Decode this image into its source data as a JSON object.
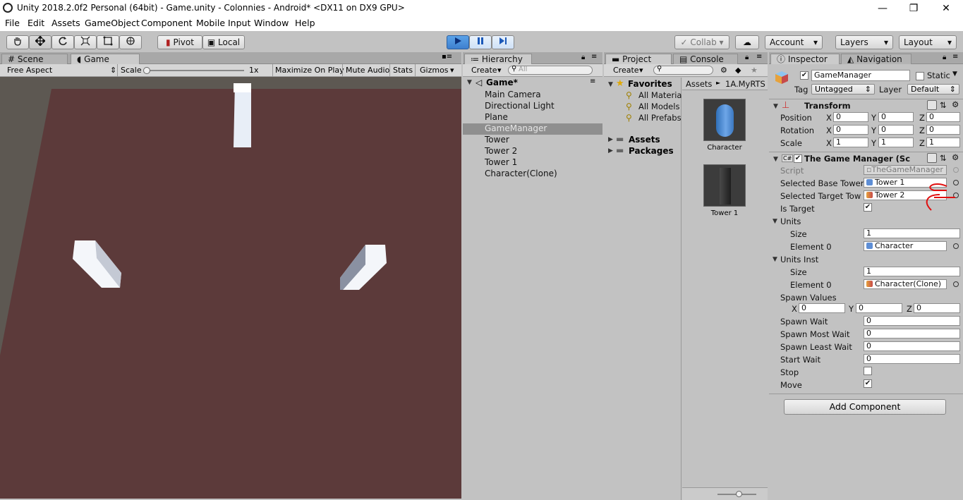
{
  "window": {
    "title": "Unity 2018.2.0f2 Personal (64bit) - Game.unity - Colonnies - Android* <DX11 on DX9 GPU>",
    "minimize": "—",
    "maximize": "❐",
    "close": "✕"
  },
  "menu": [
    "File",
    "Edit",
    "Assets",
    "GameObject",
    "Component",
    "Mobile Input",
    "Window",
    "Help"
  ],
  "toolbar": {
    "pivot": "Pivot",
    "local": "Local",
    "collab": "Collab",
    "account": "Account",
    "layers": "Layers",
    "layout": "Layout"
  },
  "tabs": {
    "scene": "Scene",
    "game": "Game",
    "hierarchy": "Hierarchy",
    "project": "Project",
    "console": "Console",
    "inspector": "Inspector",
    "navigation": "Navigation"
  },
  "game_bar": {
    "aspect": "Free Aspect",
    "scale_label": "Scale",
    "scale_value": "1x",
    "maximize": "Maximize On Play",
    "mute": "Mute Audio",
    "stats": "Stats",
    "gizmos": "Gizmos"
  },
  "hierarchy": {
    "create": "Create",
    "search_placeholder": "All",
    "scene": "Game*",
    "items": [
      "Main Camera",
      "Directional Light",
      "Plane",
      "GameManager",
      "Tower",
      "Tower 2",
      "Tower 1",
      "Character(Clone)"
    ],
    "selected_index": 3
  },
  "project": {
    "create": "Create",
    "favorites": "Favorites",
    "fav_items": [
      "All Materia",
      "All Models",
      "All Prefabs"
    ],
    "assets": "Assets",
    "packages": "Packages",
    "breadcrumb_root": "Assets",
    "breadcrumb_sep": "►",
    "breadcrumb_folder": "1A.MyRTS",
    "assets_list": [
      "Character",
      "Tower 1"
    ]
  },
  "inspector": {
    "object_name": "GameManager",
    "static_label": "Static",
    "tag_label": "Tag",
    "tag_value": "Untagged",
    "layer_label": "Layer",
    "layer_value": "Default",
    "transform": {
      "title": "Transform",
      "position_label": "Position",
      "rotation_label": "Rotation",
      "scale_label": "Scale",
      "position": [
        "0",
        "0",
        "0"
      ],
      "rotation": [
        "0",
        "0",
        "0"
      ],
      "scale": [
        "1",
        "1",
        "1"
      ],
      "axis": [
        "X",
        "Y",
        "Z"
      ]
    },
    "component": {
      "title": "The Game Manager (Sc",
      "script_label": "Script",
      "script_value": "TheGameManager",
      "base_tower_label": "Selected Base Tower",
      "base_tower_value": "Tower 1",
      "target_tower_label": "Selected Target Tow",
      "target_tower_value": "Tower 2",
      "is_target_label": "Is Target",
      "units_label": "Units",
      "units_size_label": "Size",
      "units_size": "1",
      "units_elem_label": "Element 0",
      "units_elem": "Character",
      "units_inst_label": "Units Inst",
      "inst_size_label": "Size",
      "inst_size": "1",
      "inst_elem_label": "Element 0",
      "inst_elem": "Character(Clone)",
      "spawn_values_label": "Spawn Values",
      "spawn_values": [
        "0",
        "0",
        "0"
      ],
      "spawn_wait_label": "Spawn Wait",
      "spawn_wait": "0",
      "spawn_most_label": "Spawn Most Wait",
      "spawn_most": "0",
      "spawn_least_label": "Spawn Least Wait",
      "spawn_least": "0",
      "start_wait_label": "Start Wait",
      "start_wait": "0",
      "stop_label": "Stop",
      "move_label": "Move"
    },
    "add_component": "Add Component"
  },
  "colors": {
    "ground": "#5c3a3a",
    "background": "#5d5852",
    "play_blue": "#4a90e2",
    "annotation_red": "#e01010"
  }
}
